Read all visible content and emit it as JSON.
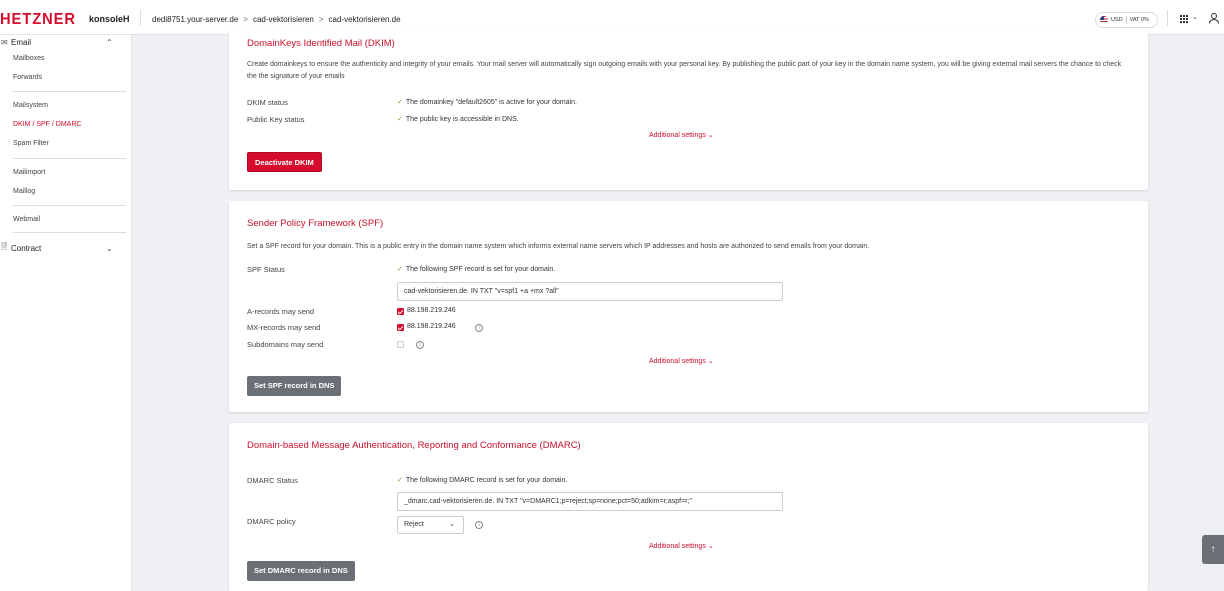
{
  "topbar": {
    "logo": "HETZNER",
    "product": "konsoleH",
    "breadcrumbs": [
      "dedi8751.your-server.de",
      "cad-vektorisieren",
      "cad-vektorisieren.de"
    ],
    "breadcrumb_sep": ">",
    "currency": "USD",
    "vat": "VAT 0%"
  },
  "sidebar": {
    "email_group": "Email",
    "items": [
      "Mailboxes",
      "Forwards",
      "Mailsystem",
      "DKIM / SPF / DMARC",
      "Spam Filter",
      "Mailimport",
      "Maillog",
      "Webmail"
    ],
    "active_item": "DKIM / SPF / DMARC",
    "contract_group": "Contract"
  },
  "dkim": {
    "title": "DomainKeys Identified Mail (DKIM)",
    "description": "Create domainkeys to ensure the authenticity and integrity of your emails. Your mail server will automatically sign outgoing emails with your personal key. By publishing the public part of your key in the domain name system, you will be giving external mail servers the chance to check the the signature of your emails",
    "status_label": "DKIM status",
    "status_value": "The domainkey \"default2605\" is active for your domain.",
    "pubkey_label": "Public Key status",
    "pubkey_value": "The public key is accessible in DNS.",
    "additional": "Additional settings",
    "button": "Deactivate DKIM"
  },
  "spf": {
    "title": "Sender Policy Framework (SPF)",
    "description": "Set a SPF record for your domain. This is a public entry in the domain name system which informs external name servers which IP addresses and hosts are authorized to send emails from your domain.",
    "status_label": "SPF Status",
    "status_value": "The following SPF record is set for your domain.",
    "record": "cad-vektorisieren.de. IN TXT \"v=spf1 +a +mx ?all\"",
    "a_label": "A-records may send",
    "a_value": "88.198.219.246",
    "a_checked": true,
    "mx_label": "MX-records may send",
    "mx_value": "88.198.219.246",
    "mx_checked": true,
    "sub_label": "Subdomains may send",
    "sub_checked": false,
    "additional": "Additional settings",
    "button": "Set SPF record in DNS"
  },
  "dmarc": {
    "title": "Domain-based Message Authentication, Reporting and Conformance (DMARC)",
    "status_label": "DMARC Status",
    "status_value": "The following DMARC record is set for your domain.",
    "record": "_dmarc.cad-vektorisieren.de. IN TXT \"v=DMARC1;p=reject;sp=none;pct=50;adkim=r;aspf=r;\"",
    "policy_label": "DMARC policy",
    "policy_value": "Reject",
    "additional": "Additional settings",
    "button": "Set DMARC record in DNS"
  },
  "colors": {
    "brand": "#d50c2d",
    "check": "#7a9a2f",
    "grey_button": "#6b7077"
  },
  "icons": [
    "mail-icon",
    "chevron-up-icon",
    "document-icon",
    "chevron-down-icon",
    "check-icon",
    "info-icon",
    "apps-grid-icon",
    "user-icon",
    "arrow-up-icon",
    "us-flag-icon"
  ]
}
